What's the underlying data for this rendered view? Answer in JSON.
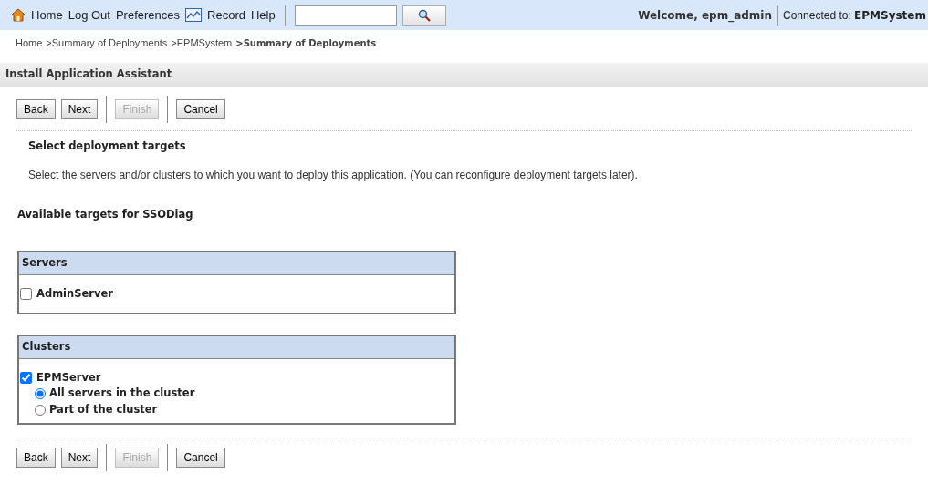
{
  "top_bar": {
    "links": [
      {
        "label": "Home",
        "kind": "home_link"
      },
      {
        "label": "Log Out"
      },
      {
        "label": "Preferences"
      },
      {
        "label": "Record",
        "kind": "record_link"
      },
      {
        "label": "Help"
      }
    ],
    "welcome": "Welcome, epm_admin",
    "connection": "Connected to: **EPMSystem**"
  },
  "breadcrumb": [
    {
      "label": "Home",
      "current": false
    },
    {
      "label": ">Summary of Deployments",
      "current": false
    },
    {
      "label": ">EPMSystem",
      "current": false
    },
    {
      "label": ">Summary of Deployments",
      "current": true
    }
  ],
  "panel_title": "Install Application Assistant",
  "buttons_top": [
    {
      "label": "Back",
      "disabled": false
    },
    {
      "label": "Next",
      "disabled": false
    },
    {
      "label": "Finish",
      "disabled": true
    },
    {
      "label": "Cancel",
      "disabled": false
    }
  ],
  "step_title": "Select deployment targets",
  "step_description": "Select the servers and/or clusters to which you want to deploy this application. (You can reconfigure deployment targets later).",
  "targets_heading": "Available targets for SSODiag",
  "servers": {
    "heading": "Servers",
    "items": [
      {
        "label": "AdminServer",
        "checked": false
      }
    ]
  },
  "clusters": {
    "heading": "Clusters",
    "items": [
      {
        "label": "EPMServer",
        "checked": true,
        "options": [
          {
            "label": "All servers in the cluster",
            "selected": true
          },
          {
            "label": "Part of the cluster",
            "selected": false
          }
        ]
      }
    ]
  },
  "buttons_bottom": [
    {
      "label": "Back",
      "disabled": false
    },
    {
      "label": "Next",
      "disabled": false
    },
    {
      "label": "Finish",
      "disabled": true
    },
    {
      "label": "Cancel",
      "disabled": false
    }
  ]
}
